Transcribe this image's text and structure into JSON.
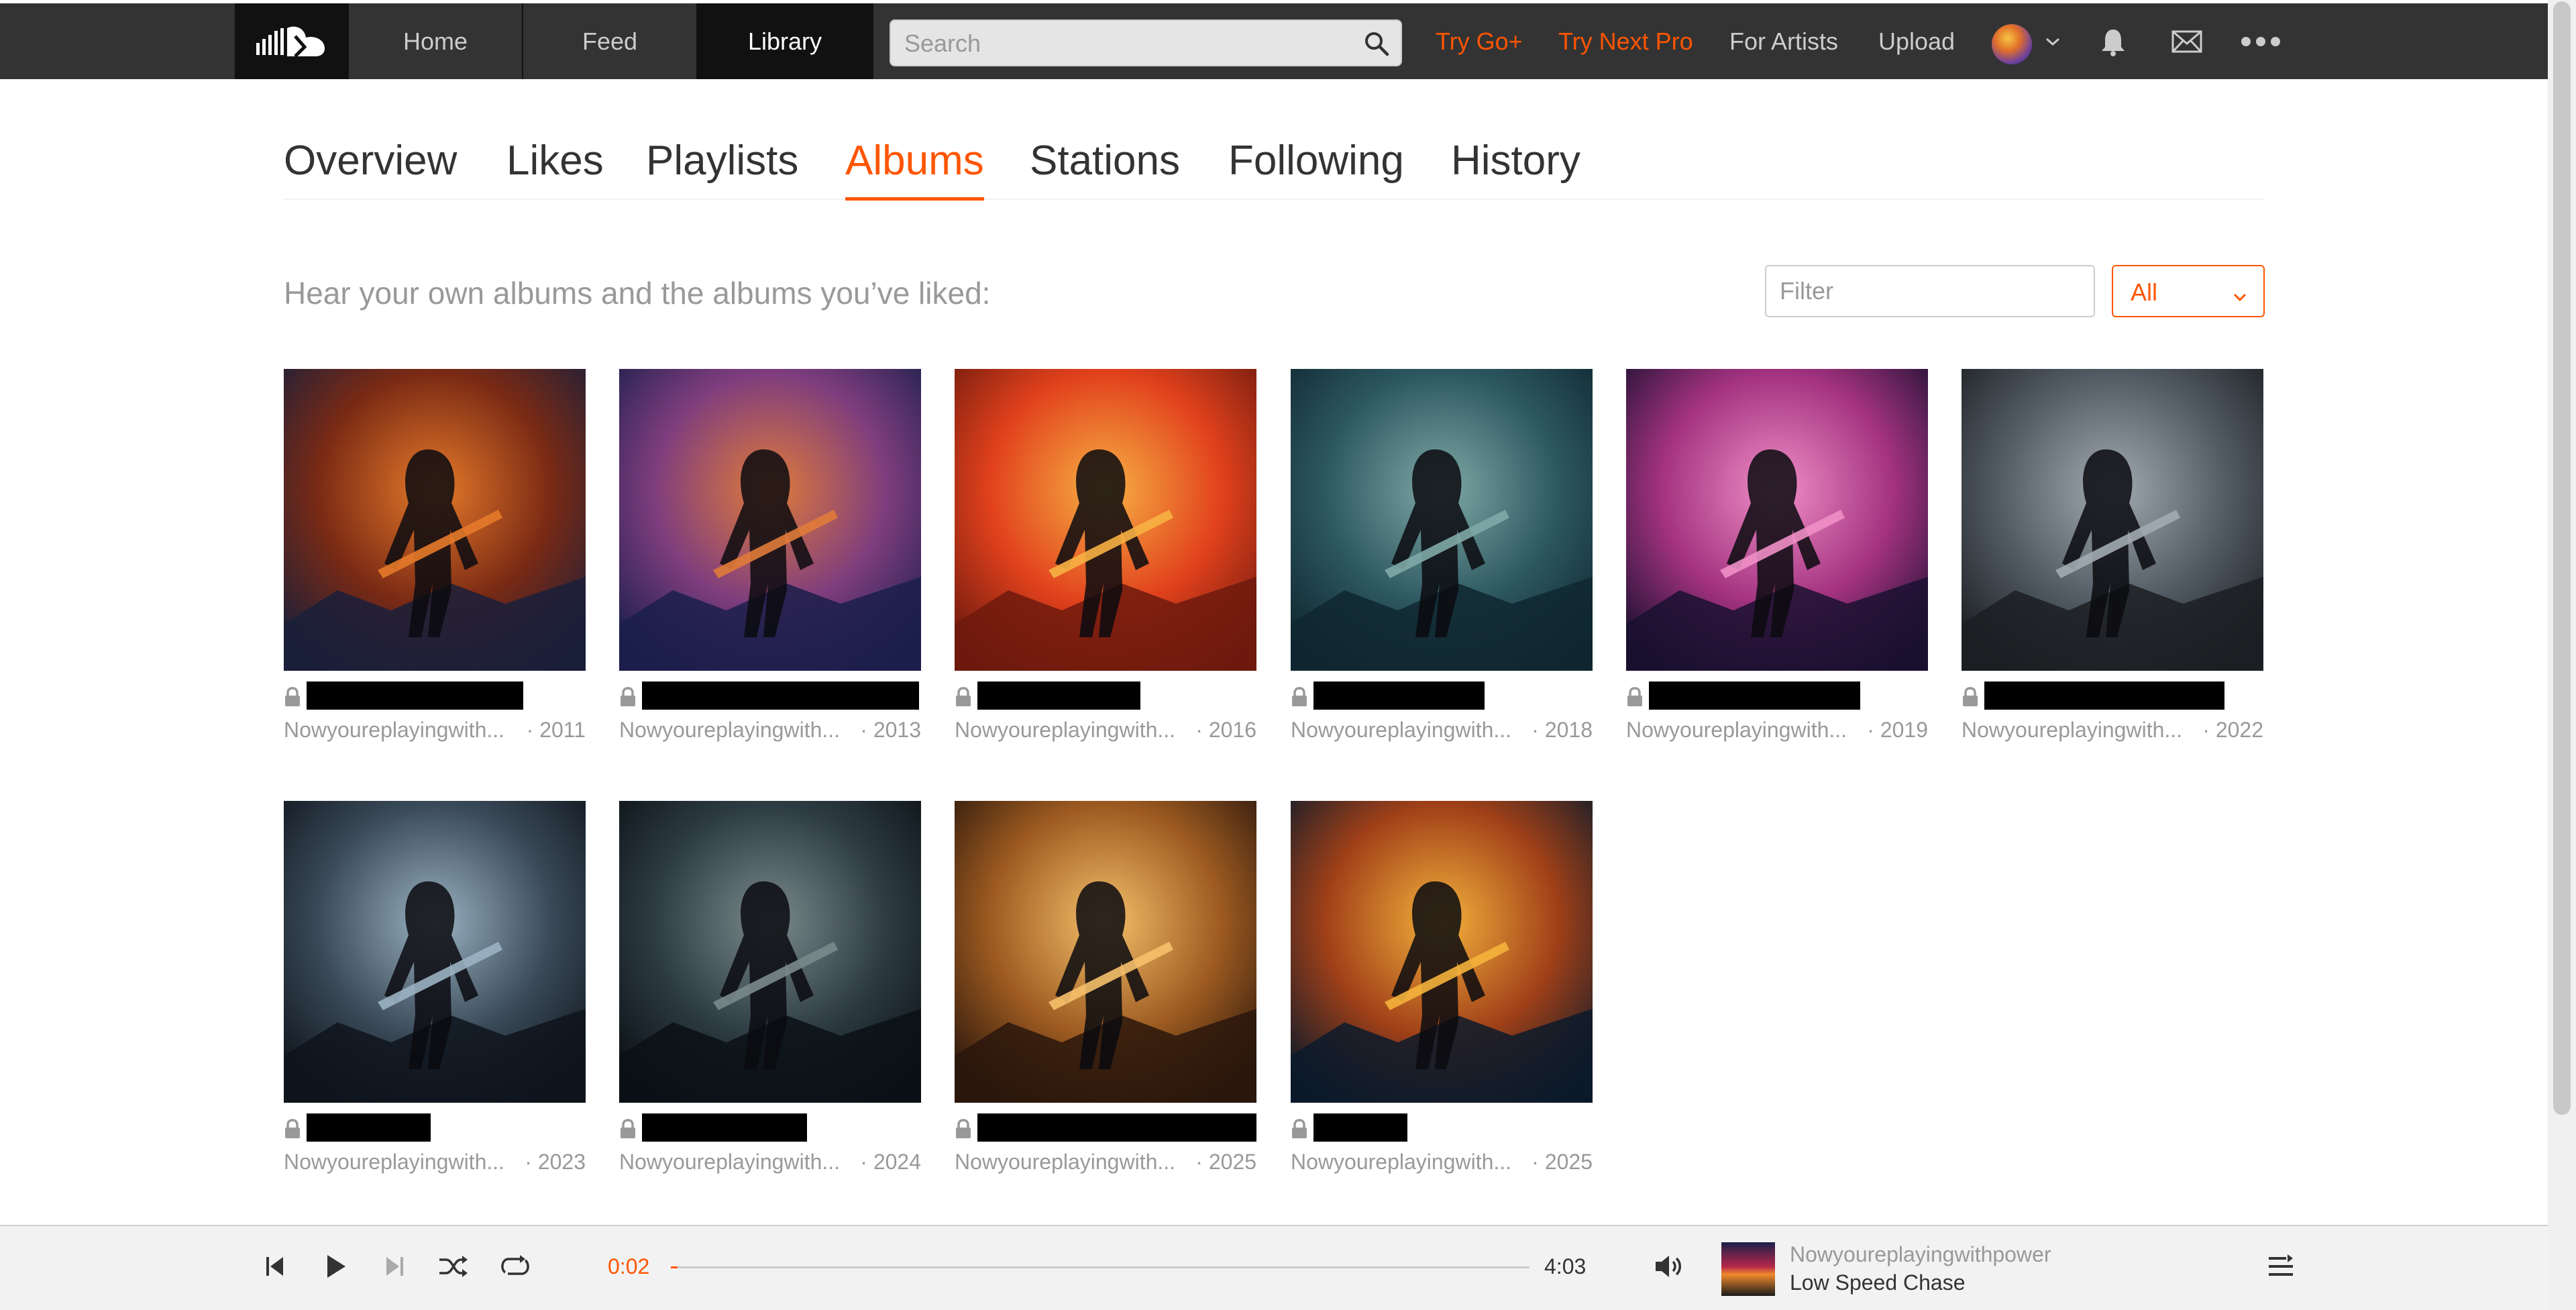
{
  "topnav": {
    "tabs": [
      {
        "label": "Home"
      },
      {
        "label": "Feed"
      },
      {
        "label": "Library",
        "active": true
      }
    ],
    "search_placeholder": "Search",
    "links": [
      {
        "label": "Try Go+",
        "color": "#ff5500"
      },
      {
        "label": "Try Next Pro",
        "color": "#ff5500"
      },
      {
        "label": "For Artists"
      },
      {
        "label": "Upload"
      }
    ],
    "icons": [
      "soundcloud-logo-icon",
      "search-icon",
      "avatar",
      "chevron-down-icon",
      "bell-icon",
      "mail-icon",
      "more-icon"
    ]
  },
  "library": {
    "tabs": [
      "Overview",
      "Likes",
      "Playlists",
      "Albums",
      "Stations",
      "Following",
      "History"
    ],
    "active_tab": "Albums",
    "intro": "Hear your own albums and the albums you’ve liked:",
    "filter_placeholder": "Filter",
    "select_value": "All",
    "accent": "#ff5500"
  },
  "albums": [
    {
      "artist": "Nowyoureplayingwith...",
      "year": "· 2011",
      "private": true
    },
    {
      "artist": "Nowyoureplayingwith...",
      "year": "· 2013",
      "private": true
    },
    {
      "artist": "Nowyoureplayingwith...",
      "year": "· 2016",
      "private": true
    },
    {
      "artist": "Nowyoureplayingwith...",
      "year": "· 2018",
      "private": true
    },
    {
      "artist": "Nowyoureplayingwith...",
      "year": "· 2019",
      "private": true
    },
    {
      "artist": "Nowyoureplayingwith...",
      "year": "· 2022",
      "private": true
    },
    {
      "artist": "Nowyoureplayingwith...",
      "year": "· 2023",
      "private": true
    },
    {
      "artist": "Nowyoureplayingwith...",
      "year": "· 2024",
      "private": true
    },
    {
      "artist": "Nowyoureplayingwith...",
      "year": "· 2025",
      "private": true
    },
    {
      "artist": "Nowyoureplayingwith...",
      "year": "· 2025",
      "private": true
    }
  ],
  "player": {
    "current_time": "0:02",
    "total_time": "4:03",
    "progress": 0.008,
    "artist": "Nowyoureplayingwithpower",
    "title": "Low Speed Chase",
    "controls": [
      "skip-back-icon",
      "play-icon",
      "skip-forward-icon",
      "shuffle-icon",
      "repeat-icon",
      "volume-icon",
      "queue-icon"
    ]
  }
}
